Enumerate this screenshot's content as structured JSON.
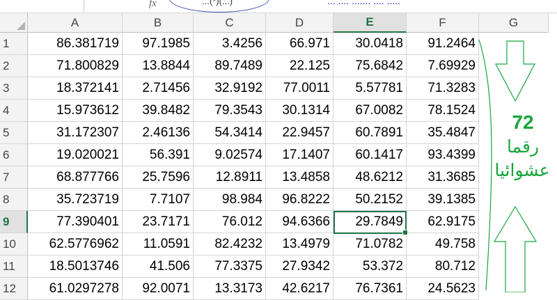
{
  "formula_bar": {
    "fx_label": "fx",
    "formula_text": "...(*)(...)",
    "top_caption": "..... .... ....... .... ..."
  },
  "columns": [
    "A",
    "B",
    "C",
    "D",
    "E",
    "F",
    "G"
  ],
  "active_column": "E",
  "active_row": "9",
  "rows": [
    {
      "num": "1",
      "cells": [
        "86.381719",
        "97.1985",
        "3.4256",
        "66.971",
        "30.0418",
        "91.2464"
      ]
    },
    {
      "num": "2",
      "cells": [
        "71.800829",
        "13.8844",
        "89.7489",
        "22.125",
        "75.6842",
        "7.69929"
      ]
    },
    {
      "num": "3",
      "cells": [
        "18.372141",
        "2.71456",
        "32.9192",
        "77.0011",
        "5.57781",
        "71.3283"
      ]
    },
    {
      "num": "4",
      "cells": [
        "15.973612",
        "39.8482",
        "79.3543",
        "30.1314",
        "67.0082",
        "78.1524"
      ]
    },
    {
      "num": "5",
      "cells": [
        "31.172307",
        "2.46136",
        "54.3414",
        "22.9457",
        "60.7891",
        "35.4847"
      ]
    },
    {
      "num": "6",
      "cells": [
        "19.020021",
        "56.391",
        "9.02574",
        "17.1407",
        "60.1417",
        "93.4399"
      ]
    },
    {
      "num": "7",
      "cells": [
        "68.877766",
        "25.7596",
        "12.8911",
        "13.4858",
        "48.6212",
        "31.3685"
      ]
    },
    {
      "num": "8",
      "cells": [
        "35.723719",
        "7.7107",
        "98.984",
        "96.8222",
        "50.2152",
        "39.1385"
      ]
    },
    {
      "num": "9",
      "cells": [
        "77.390401",
        "23.7171",
        "76.012",
        "94.6366",
        "29.7849",
        "62.9175"
      ]
    },
    {
      "num": "10",
      "cells": [
        "62.5776962",
        "11.0591",
        "82.4232",
        "13.4979",
        "71.0782",
        "49.758"
      ]
    },
    {
      "num": "11",
      "cells": [
        "18.5013746",
        "41.506",
        "77.3375",
        "27.9342",
        "53.372",
        "80.712"
      ]
    },
    {
      "num": "12",
      "cells": [
        "61.0297278",
        "92.0071",
        "13.3173",
        "42.6217",
        "76.7361",
        "24.5623"
      ]
    }
  ],
  "annotation": {
    "number": "72",
    "word1": "رقما",
    "word2": "عشوائيا",
    "color": "#15a63a"
  },
  "colors": {
    "excel_green": "#217346",
    "grid_line": "#d4d4d4",
    "header_bg": "#f3f3f3"
  }
}
